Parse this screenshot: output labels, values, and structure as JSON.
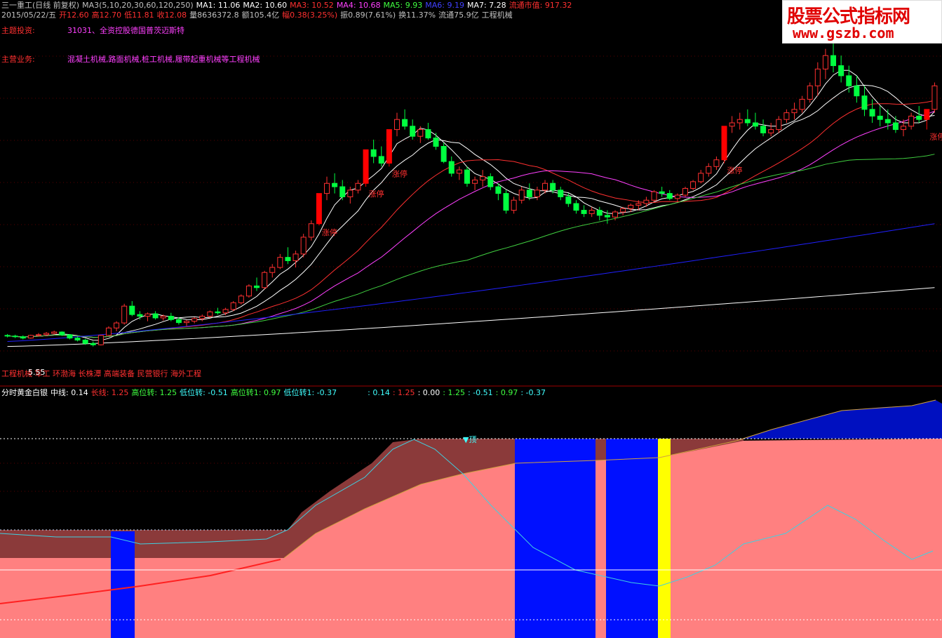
{
  "header": {
    "line1": [
      {
        "text": "三一重工(日线 前复权)",
        "color": "#c0c0c0"
      },
      {
        "text": "MA3(5,10,20,30,60,120,250)",
        "color": "#c0c0c0"
      },
      {
        "text": "MA1: 11.06",
        "color": "#ffffff"
      },
      {
        "text": "MA2: 10.60",
        "color": "#ffffff"
      },
      {
        "text": "MA3: 10.52",
        "color": "#ff3030"
      },
      {
        "text": "MA4: 10.68",
        "color": "#ff40ff"
      },
      {
        "text": "MA5: 9.93",
        "color": "#40ff40"
      },
      {
        "text": "MA6: 9.19",
        "color": "#4040ff"
      },
      {
        "text": "MA7: 7.28",
        "color": "#ffffff"
      },
      {
        "text": "流通市值: 917.32",
        "color": "#ff3030"
      }
    ],
    "line2": [
      {
        "text": "2015/05/22/五",
        "color": "#c0c0c0"
      },
      {
        "text": "开12.60",
        "color": "#ff3030"
      },
      {
        "text": "高12.70",
        "color": "#ff3030"
      },
      {
        "text": "低11.81",
        "color": "#ff3030"
      },
      {
        "text": "收12.08",
        "color": "#ff3030"
      },
      {
        "text": "量8636372.8",
        "color": "#c0c0c0"
      },
      {
        "text": "额105.4亿",
        "color": "#c0c0c0"
      },
      {
        "text": "幅0.38(3.25%)",
        "color": "#ff3030"
      },
      {
        "text": "振0.89(7.61%)",
        "color": "#c0c0c0"
      },
      {
        "text": "换11.37%",
        "color": "#c0c0c0"
      },
      {
        "text": "流通75.9亿",
        "color": "#c0c0c0"
      },
      {
        "text": "工程机械",
        "color": "#c0c0c0"
      }
    ],
    "theme_label": "主题投资:",
    "theme_value": "31031、全资控股德国普茨迈斯特",
    "business_label": "主营业务:",
    "business_value": "混凝土机械,路面机械,桩工机械,履带起重机械等工程机械",
    "bottom_tags": "工程机械 军工 环渤海 长株潭 高端装备 民营银行 海外工程",
    "low_price_label": "5.55"
  },
  "indicator": {
    "title": "分时黄金白银",
    "items": [
      {
        "text": "中线: 0.14",
        "color": "#ffffff"
      },
      {
        "text": "长线: 1.25",
        "color": "#ff3030"
      },
      {
        "text": "高位转: 1.25",
        "color": "#40ff40"
      },
      {
        "text": "低位转: -0.51",
        "color": "#40ffff"
      },
      {
        "text": "高位转1: 0.97",
        "color": "#40ff40"
      },
      {
        "text": "低位转1: -0.37",
        "color": "#40ffff"
      },
      {
        "text": ": 0.14",
        "color": "#40ffff"
      },
      {
        "text": ": 1.25",
        "color": "#ff3030"
      },
      {
        "text": ": 0.00",
        "color": "#ffffff"
      },
      {
        "text": ": 1.25",
        "color": "#40ff40"
      },
      {
        "text": ": -0.51",
        "color": "#40ffff"
      },
      {
        "text": ": 0.97",
        "color": "#40ff40"
      },
      {
        "text": ": -0.37",
        "color": "#40ffff"
      }
    ],
    "top_label": "▼顶"
  },
  "watermark": {
    "title": "股票公式指标网",
    "url": "www.gszb.com"
  },
  "chart_data": {
    "type": "candlestick",
    "price_range": [
      5.0,
      13.0
    ],
    "limit_up_label": "涨停",
    "limit_up_candles": [
      40,
      46,
      49,
      92,
      118
    ],
    "candles": [
      [
        5.88,
        5.92,
        5.82,
        5.86
      ],
      [
        5.86,
        5.9,
        5.8,
        5.84
      ],
      [
        5.84,
        5.88,
        5.76,
        5.8
      ],
      [
        5.8,
        5.9,
        5.78,
        5.88
      ],
      [
        5.88,
        5.95,
        5.84,
        5.9
      ],
      [
        5.9,
        5.98,
        5.86,
        5.94
      ],
      [
        5.94,
        6.02,
        5.9,
        5.98
      ],
      [
        5.98,
        6.0,
        5.86,
        5.9
      ],
      [
        5.9,
        5.92,
        5.76,
        5.8
      ],
      [
        5.8,
        5.84,
        5.7,
        5.74
      ],
      [
        5.74,
        5.78,
        5.6,
        5.64
      ],
      [
        5.64,
        5.7,
        5.55,
        5.6
      ],
      [
        5.6,
        5.9,
        5.58,
        5.88
      ],
      [
        5.88,
        6.15,
        5.86,
        6.1
      ],
      [
        6.1,
        6.3,
        6.0,
        6.25
      ],
      [
        6.25,
        6.82,
        6.2,
        6.75
      ],
      [
        6.75,
        6.9,
        6.45,
        6.5
      ],
      [
        6.5,
        6.6,
        6.35,
        6.45
      ],
      [
        6.45,
        6.56,
        6.3,
        6.52
      ],
      [
        6.52,
        6.6,
        6.35,
        6.4
      ],
      [
        6.4,
        6.5,
        6.32,
        6.45
      ],
      [
        6.45,
        6.55,
        6.3,
        6.35
      ],
      [
        6.35,
        6.42,
        6.2,
        6.26
      ],
      [
        6.26,
        6.34,
        6.16,
        6.3
      ],
      [
        6.3,
        6.42,
        6.24,
        6.38
      ],
      [
        6.38,
        6.5,
        6.3,
        6.45
      ],
      [
        6.45,
        6.62,
        6.4,
        6.58
      ],
      [
        6.58,
        6.7,
        6.5,
        6.55
      ],
      [
        6.55,
        6.7,
        6.48,
        6.65
      ],
      [
        6.65,
        6.9,
        6.6,
        6.85
      ],
      [
        6.85,
        7.1,
        6.8,
        7.05
      ],
      [
        7.05,
        7.4,
        7.0,
        7.35
      ],
      [
        7.35,
        7.6,
        7.2,
        7.3
      ],
      [
        7.3,
        7.8,
        7.25,
        7.75
      ],
      [
        7.75,
        8.0,
        7.6,
        7.9
      ],
      [
        7.9,
        8.3,
        7.85,
        8.2
      ],
      [
        8.2,
        8.5,
        8.0,
        8.1
      ],
      [
        8.1,
        8.4,
        7.9,
        8.3
      ],
      [
        8.3,
        8.9,
        8.2,
        8.8
      ],
      [
        8.8,
        9.3,
        8.7,
        9.2
      ],
      [
        9.2,
        10.1,
        9.15,
        10.1
      ],
      [
        10.1,
        10.6,
        9.9,
        10.4
      ],
      [
        10.4,
        10.7,
        10.1,
        10.3
      ],
      [
        10.3,
        10.5,
        9.9,
        10.0
      ],
      [
        10.0,
        10.3,
        9.8,
        10.2
      ],
      [
        10.2,
        10.5,
        10.1,
        10.4
      ],
      [
        10.4,
        11.4,
        10.3,
        11.4
      ],
      [
        11.4,
        11.7,
        11.0,
        11.2
      ],
      [
        11.2,
        11.5,
        10.9,
        11.0
      ],
      [
        11.0,
        12.0,
        10.9,
        12.0
      ],
      [
        12.0,
        12.5,
        11.8,
        12.3
      ],
      [
        12.3,
        12.6,
        12.0,
        12.1
      ],
      [
        12.1,
        12.3,
        11.7,
        11.8
      ],
      [
        11.8,
        12.1,
        11.6,
        12.0
      ],
      [
        12.0,
        12.2,
        11.7,
        11.75
      ],
      [
        11.75,
        11.9,
        11.4,
        11.5
      ],
      [
        11.5,
        11.6,
        11.0,
        11.05
      ],
      [
        11.05,
        11.2,
        10.6,
        10.7
      ],
      [
        10.7,
        10.9,
        10.5,
        10.8
      ],
      [
        10.8,
        10.9,
        10.3,
        10.4
      ],
      [
        10.4,
        10.6,
        10.2,
        10.5
      ],
      [
        10.5,
        10.8,
        10.3,
        10.6
      ],
      [
        10.6,
        10.7,
        10.2,
        10.3
      ],
      [
        10.3,
        10.4,
        9.9,
        10.1
      ],
      [
        10.1,
        10.2,
        9.5,
        9.6
      ],
      [
        9.6,
        10.0,
        9.5,
        9.9
      ],
      [
        9.9,
        10.3,
        9.8,
        10.2
      ],
      [
        10.2,
        10.4,
        9.9,
        10.0
      ],
      [
        10.0,
        10.3,
        9.9,
        10.2
      ],
      [
        10.2,
        10.5,
        10.1,
        10.4
      ],
      [
        10.4,
        10.5,
        10.1,
        10.2
      ],
      [
        10.2,
        10.3,
        9.9,
        10.0
      ],
      [
        10.0,
        10.1,
        9.7,
        9.8
      ],
      [
        9.8,
        9.9,
        9.5,
        9.6
      ],
      [
        9.6,
        9.75,
        9.4,
        9.5
      ],
      [
        9.5,
        9.7,
        9.4,
        9.6
      ],
      [
        9.6,
        9.7,
        9.3,
        9.45
      ],
      [
        9.45,
        9.6,
        9.2,
        9.4
      ],
      [
        9.4,
        9.6,
        9.3,
        9.55
      ],
      [
        9.55,
        9.7,
        9.45,
        9.65
      ],
      [
        9.65,
        9.8,
        9.55,
        9.75
      ],
      [
        9.75,
        9.9,
        9.6,
        9.8
      ],
      [
        9.8,
        10.0,
        9.7,
        9.9
      ],
      [
        9.9,
        10.2,
        9.85,
        10.15
      ],
      [
        10.15,
        10.3,
        10.0,
        10.1
      ],
      [
        10.1,
        10.2,
        9.9,
        9.95
      ],
      [
        9.95,
        10.1,
        9.85,
        10.05
      ],
      [
        10.05,
        10.3,
        10.0,
        10.25
      ],
      [
        10.25,
        10.5,
        10.2,
        10.45
      ],
      [
        10.45,
        10.8,
        10.4,
        10.7
      ],
      [
        10.7,
        11.0,
        10.6,
        10.9
      ],
      [
        10.9,
        11.2,
        10.8,
        11.1
      ],
      [
        11.1,
        12.1,
        11.0,
        12.1
      ],
      [
        12.1,
        12.4,
        11.9,
        12.2
      ],
      [
        12.2,
        12.5,
        12.0,
        12.3
      ],
      [
        12.3,
        12.6,
        12.1,
        12.2
      ],
      [
        12.2,
        12.5,
        12.0,
        12.1
      ],
      [
        12.1,
        12.3,
        11.8,
        11.9
      ],
      [
        11.9,
        12.2,
        11.8,
        12.0
      ],
      [
        12.0,
        12.4,
        11.9,
        12.3
      ],
      [
        12.3,
        12.6,
        12.2,
        12.5
      ],
      [
        12.5,
        12.8,
        12.3,
        12.6
      ],
      [
        12.6,
        13.0,
        12.5,
        12.9
      ],
      [
        12.9,
        13.4,
        12.8,
        13.3
      ],
      [
        13.3,
        14.0,
        13.0,
        13.8
      ],
      [
        13.8,
        14.4,
        13.5,
        14.2
      ],
      [
        14.2,
        14.6,
        13.7,
        13.9
      ],
      [
        13.9,
        14.2,
        13.4,
        13.6
      ],
      [
        13.6,
        13.9,
        13.1,
        13.3
      ],
      [
        13.3,
        13.6,
        12.8,
        13.0
      ],
      [
        13.0,
        13.3,
        12.4,
        12.6
      ],
      [
        12.6,
        12.9,
        12.2,
        12.4
      ],
      [
        12.4,
        12.7,
        12.1,
        12.3
      ],
      [
        12.3,
        12.6,
        12.0,
        12.2
      ],
      [
        12.2,
        12.4,
        11.9,
        12.0
      ],
      [
        12.0,
        12.3,
        11.8,
        12.1
      ],
      [
        12.1,
        12.5,
        12.0,
        12.4
      ],
      [
        12.4,
        12.7,
        12.2,
        12.3
      ],
      [
        12.3,
        12.6,
        12.0,
        12.6
      ],
      [
        12.6,
        13.4,
        12.5,
        13.3
      ]
    ],
    "ma_colors": [
      "#ffffff",
      "#ffffff",
      "#ff3030",
      "#ff40ff",
      "#40d040",
      "#2020ff",
      "#ffffff"
    ]
  }
}
